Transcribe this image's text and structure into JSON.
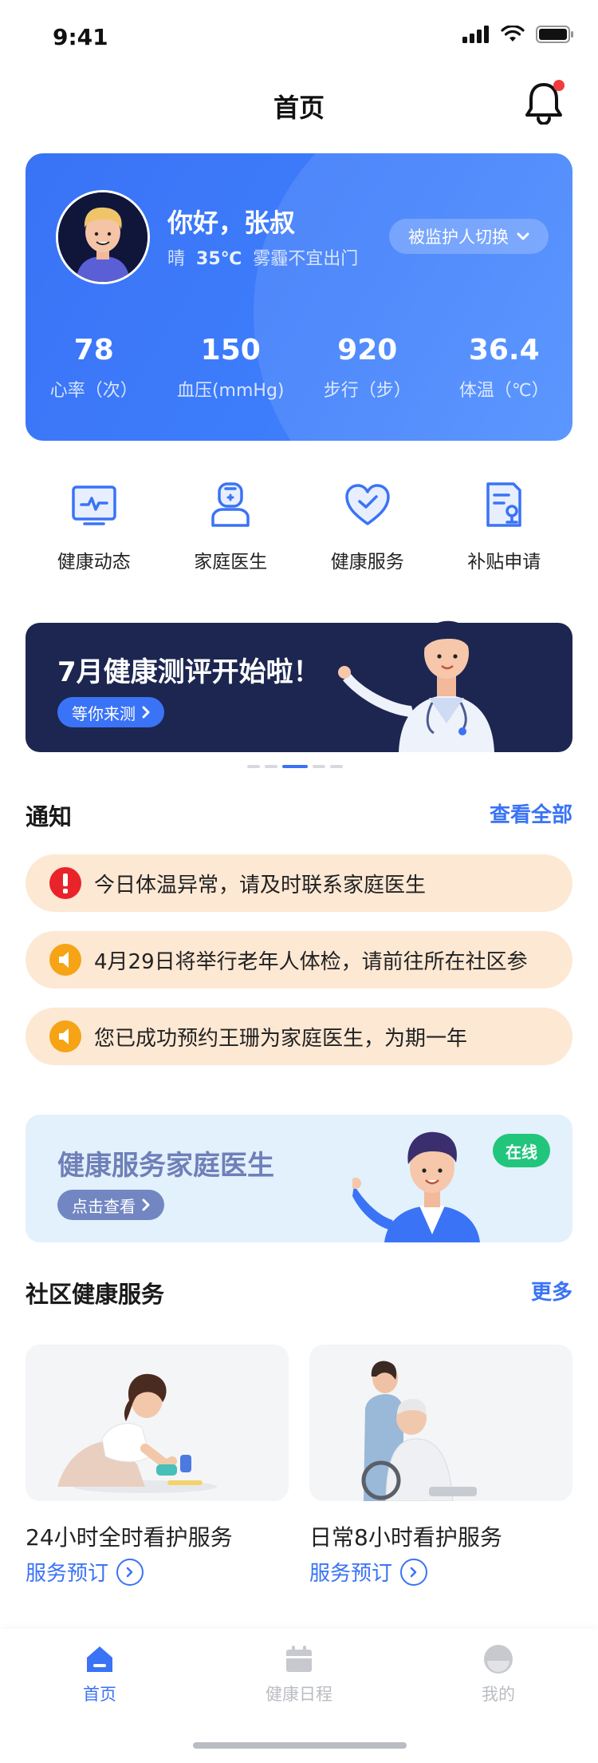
{
  "status_bar": {
    "time": "9:41"
  },
  "header": {
    "title": "首页"
  },
  "profile": {
    "greeting": "你好，张叔",
    "weather_prefix": "晴",
    "temperature": "35℃",
    "weather_note": "雾霾不宜出门",
    "switch_label": "被监护人切换",
    "stats": [
      {
        "value": "78",
        "label": "心率（次）"
      },
      {
        "value": "150",
        "label": "血压(mmHg)"
      },
      {
        "value": "920",
        "label": "步行（步）"
      },
      {
        "value": "36.4",
        "label": "体温（℃）"
      }
    ]
  },
  "quick_menu": [
    {
      "label": "健康动态",
      "icon": "health-trend-icon"
    },
    {
      "label": "家庭医生",
      "icon": "doctor-icon"
    },
    {
      "label": "健康服务",
      "icon": "heart-icon"
    },
    {
      "label": "补贴申请",
      "icon": "subsidy-icon"
    }
  ],
  "banner": {
    "title": "7月健康测评开始啦！",
    "button": "等你来测"
  },
  "notifications": {
    "title": "通知",
    "more": "查看全部",
    "items": [
      {
        "text": "今日体温异常，请及时联系家庭医生",
        "icon": "alert-icon",
        "color": "#e8232a"
      },
      {
        "text": "4月29日将举行老年人体检，请前往所在社区参",
        "icon": "speaker-icon",
        "color": "#f6a315"
      },
      {
        "text": "您已成功预约王珊为家庭医生，为期一年",
        "icon": "speaker-icon",
        "color": "#f6a315"
      }
    ]
  },
  "family_doctor": {
    "title": "健康服务家庭医生",
    "button": "点击查看",
    "badge": "在线"
  },
  "community": {
    "title": "社区健康服务",
    "more": "更多",
    "services": [
      {
        "name": "24小时全时看护服务",
        "book": "服务预订"
      },
      {
        "name": "日常8小时看护服务",
        "book": "服务预订"
      }
    ]
  },
  "tabbar": [
    {
      "label": "首页",
      "active": true
    },
    {
      "label": "健康日程",
      "active": false
    },
    {
      "label": "我的",
      "active": false
    }
  ],
  "colors": {
    "primary": "#3a73f6",
    "notice_bg": "#fde8d4",
    "online": "#22c57c"
  }
}
